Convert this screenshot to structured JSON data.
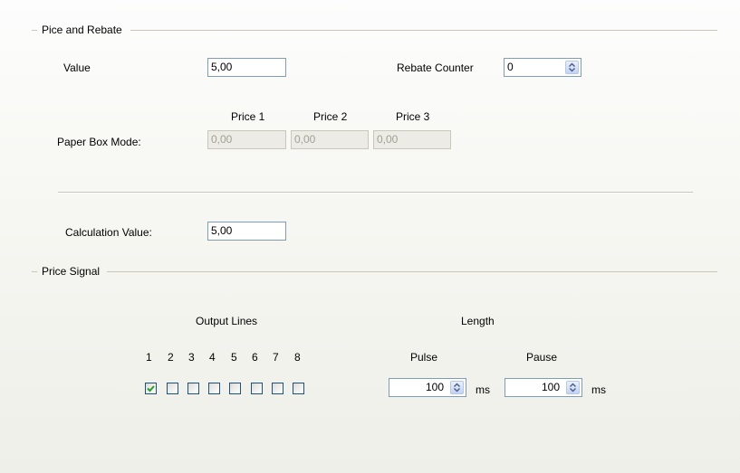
{
  "price_rebate": {
    "title": "Pice and Rebate",
    "value_label": "Value",
    "value": "5,00",
    "rebate_counter_label": "Rebate Counter",
    "rebate_counter_value": "0",
    "price_headers": [
      "Price 1",
      "Price 2",
      "Price 3"
    ],
    "paper_box_mode_label": "Paper Box Mode:",
    "paper_box_values": [
      "0,00",
      "0,00",
      "0,00"
    ],
    "calculation_value_label": "Calculation Value:",
    "calculation_value": "5,00"
  },
  "price_signal": {
    "title": "Price Signal",
    "output_lines_label": "Output Lines",
    "length_label": "Length",
    "line_numbers": [
      "1",
      "2",
      "3",
      "4",
      "5",
      "6",
      "7",
      "8"
    ],
    "line_checked": [
      true,
      false,
      false,
      false,
      false,
      false,
      false,
      false
    ],
    "pulse_label": "Pulse",
    "pause_label": "Pause",
    "pulse_value": "100",
    "pause_value": "100",
    "unit_ms": "ms"
  },
  "icons": {
    "spinner": "spin-up-down-icon",
    "checkmark": "check-icon"
  },
  "colors": {
    "input_border": "#7f9db9",
    "checkbox_border": "#1c5180",
    "check_color": "#21a121",
    "group_line": "#c9c7ba"
  }
}
